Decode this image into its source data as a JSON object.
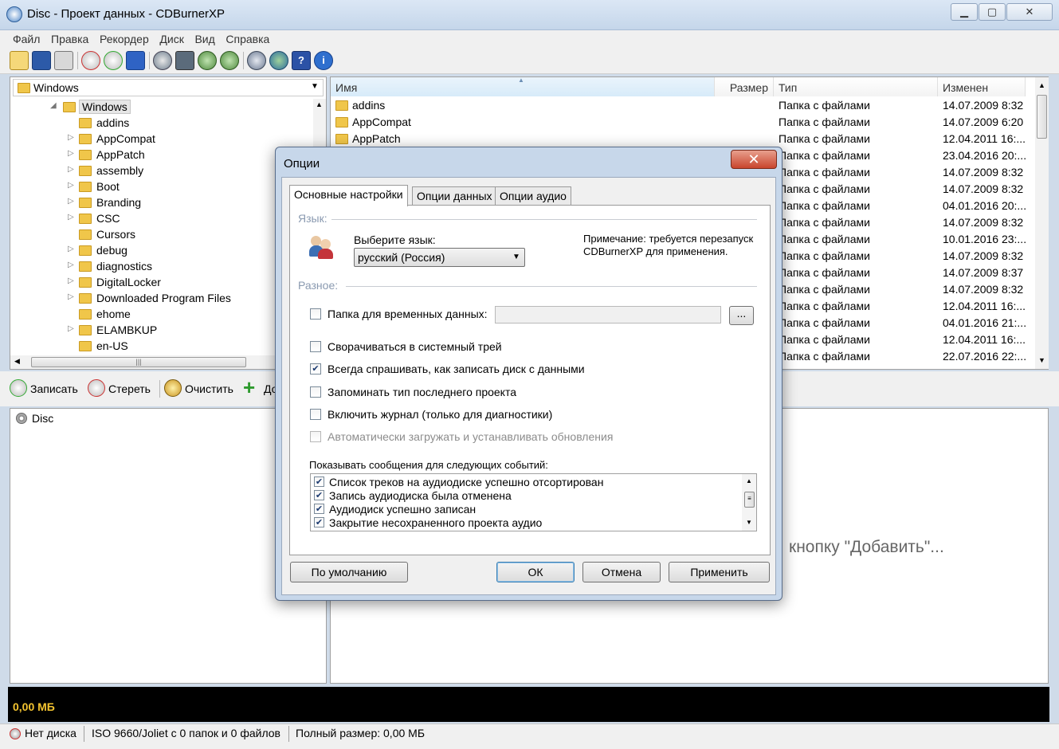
{
  "window": {
    "title": "Disc - Проект данных - CDBurnerXP"
  },
  "menu": [
    "Файл",
    "Правка",
    "Рекордер",
    "Диск",
    "Вид",
    "Справка"
  ],
  "folder_combo": {
    "value": "Windows"
  },
  "tree": {
    "root": "Windows",
    "items": [
      "addins",
      "AppCompat",
      "AppPatch",
      "assembly",
      "Boot",
      "Branding",
      "CSC",
      "Cursors",
      "debug",
      "diagnostics",
      "DigitalLocker",
      "Downloaded Program Files",
      "ehome",
      "ELAMBKUP",
      "en-US"
    ],
    "hscroll_grip": "|||"
  },
  "file_list": {
    "columns": {
      "name": "Имя",
      "size": "Размер",
      "type": "Тип",
      "modified": "Изменен"
    },
    "rows": [
      {
        "name": "addins",
        "type": "Папка с файлами",
        "modified": "14.07.2009 8:32"
      },
      {
        "name": "AppCompat",
        "type": "Папка с файлами",
        "modified": "14.07.2009 6:20"
      },
      {
        "name": "AppPatch",
        "type": "Папка с файлами",
        "modified": "12.04.2011 16:..."
      },
      {
        "name": "",
        "type": "Папка с файлами",
        "modified": "23.04.2016 20:..."
      },
      {
        "name": "",
        "type": "Папка с файлами",
        "modified": "14.07.2009 8:32"
      },
      {
        "name": "",
        "type": "Папка с файлами",
        "modified": "14.07.2009 8:32"
      },
      {
        "name": "",
        "type": "Папка с файлами",
        "modified": "04.01.2016 20:..."
      },
      {
        "name": "",
        "type": "Папка с файлами",
        "modified": "14.07.2009 8:32"
      },
      {
        "name": "",
        "type": "Папка с файлами",
        "modified": "10.01.2016 23:..."
      },
      {
        "name": "",
        "type": "Папка с файлами",
        "modified": "14.07.2009 8:32"
      },
      {
        "name": "",
        "type": "Папка с файлами",
        "modified": "14.07.2009 8:37"
      },
      {
        "name": "",
        "type": "Папка с файлами",
        "modified": "14.07.2009 8:32"
      },
      {
        "name": "",
        "type": "Папка с файлами",
        "modified": "12.04.2011 16:..."
      },
      {
        "name": "",
        "type": "Папка с файлами",
        "modified": "04.01.2016 21:..."
      },
      {
        "name": "",
        "type": "Папка с файлами",
        "modified": "12.04.2011 16:..."
      },
      {
        "name": "",
        "type": "Папка с файлами",
        "modified": "22.07.2016 22:..."
      }
    ]
  },
  "actions": {
    "burn": "Записать",
    "erase": "Стереть",
    "clear": "Очистить",
    "add_partial": "До"
  },
  "disc_tree": {
    "root": "Disc"
  },
  "content_hint": "кнопку \"Добавить\"...",
  "size_bar": {
    "value": "0,00 МБ"
  },
  "status": {
    "disc": "Нет диска",
    "fs": "ISO 9660/Joliet с 0 папок и 0 файлов",
    "total": "Полный размер: 0,00 МБ"
  },
  "dialog": {
    "title": "Опции",
    "close_glyph": "✕",
    "tabs": [
      "Основные настройки",
      "Опции данных",
      "Опции аудио"
    ],
    "language_group": "Язык:",
    "language_label": "Выберите язык:",
    "language_value": "русский (Россия)",
    "language_note": "Примечание: требуется перезапуск CDBurnerXP для применения.",
    "misc_group": "Разное:",
    "temp_folder_label": "Папка для временных данных:",
    "temp_folder_value": "",
    "browse_label": "...",
    "options": [
      {
        "label": "Сворачиваться в системный трей",
        "checked": false,
        "disabled": false
      },
      {
        "label": "Всегда спрашивать, как записать диск с данными",
        "checked": true,
        "disabled": false
      },
      {
        "label": "Запоминать тип последнего проекта",
        "checked": false,
        "disabled": false
      },
      {
        "label": "Включить журнал (только для диагностики)",
        "checked": false,
        "disabled": false
      },
      {
        "label": "Автоматически загружать и устанавливать обновления",
        "checked": false,
        "disabled": true
      }
    ],
    "events_label": "Показывать сообщения для следующих событий:",
    "events": [
      "Список треков на аудиодиске успешно отсортирован",
      "Запись аудиодиска была отменена",
      "Аудиодиск успешно записан",
      "Закрытие несохраненного проекта аудио"
    ],
    "buttons": {
      "defaults": "По умолчанию",
      "ok": "ОК",
      "cancel": "Отмена",
      "apply": "Применить"
    }
  },
  "colors": {
    "size_text": "#f4c430",
    "dialog_frame": "#c7d7ea",
    "close_button": "#c9452d"
  }
}
